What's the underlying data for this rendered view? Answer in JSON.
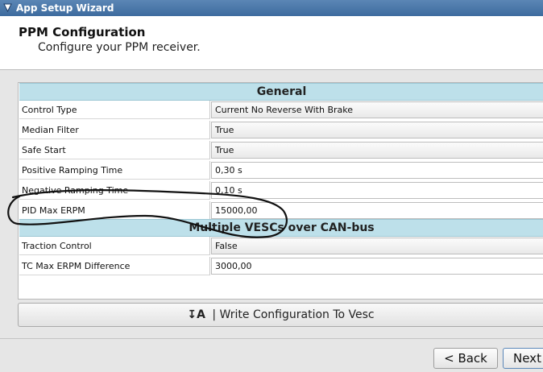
{
  "window": {
    "title": "App Setup Wizard"
  },
  "header": {
    "title": "PPM Configuration",
    "subtitle": "Configure your PPM receiver."
  },
  "sections": {
    "general": "General",
    "can": "Multiple VESCs over CAN-bus"
  },
  "general_rows": [
    {
      "label": "Control Type",
      "value": "Current No Reverse With Brake"
    },
    {
      "label": "Median Filter",
      "value": "True"
    },
    {
      "label": "Safe Start",
      "value": "True"
    },
    {
      "label": "Positive Ramping Time",
      "value": "0,30 s"
    },
    {
      "label": "Negative Ramping Time",
      "value": "0,10 s"
    },
    {
      "label": "PID Max ERPM",
      "value": "15000,00"
    }
  ],
  "can_rows": [
    {
      "label": "Traction Control",
      "value": "False"
    },
    {
      "label": "TC Max ERPM Difference",
      "value": "3000,00"
    }
  ],
  "write_button": {
    "icon": "↧A",
    "label": "| Write Configuration To Vesc"
  },
  "nav": {
    "back": "< Back",
    "next": "Next"
  },
  "colors": {
    "section_header": "#bde0ea",
    "titlebar": "#4a76a8"
  }
}
